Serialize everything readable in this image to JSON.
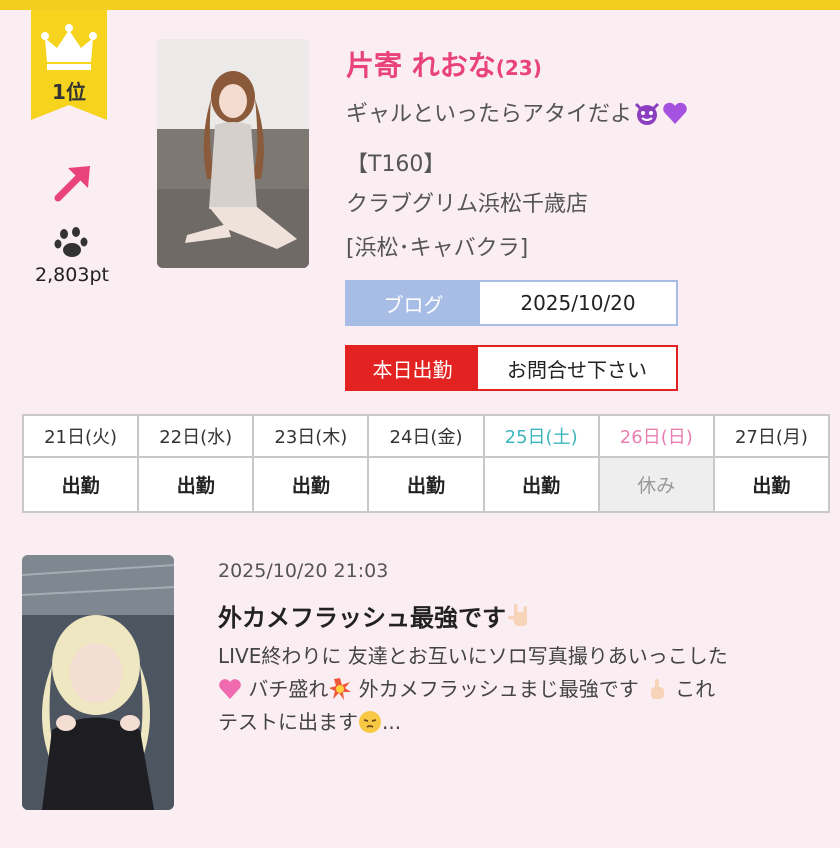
{
  "rank": {
    "label": "1位",
    "trend": "up-right-arrow-icon",
    "points": "2,803pt"
  },
  "cast": {
    "name": "片寄 れおな",
    "age": "(23)",
    "catch": "ギャルといったらアタイだよ",
    "height": "【T160】",
    "shop": "クラブグリム浜松千歳店",
    "area": "[浜松･キャバクラ]"
  },
  "blog_info": {
    "label": "ブログ",
    "date": "2025/10/20"
  },
  "work_info": {
    "label": "本日出勤",
    "value": "お問合せ下さい"
  },
  "schedule": [
    {
      "day": "21日(火)",
      "status": "出勤"
    },
    {
      "day": "22日(水)",
      "status": "出勤"
    },
    {
      "day": "23日(木)",
      "status": "出勤"
    },
    {
      "day": "24日(金)",
      "status": "出勤"
    },
    {
      "day": "25日(土)",
      "status": "出勤"
    },
    {
      "day": "26日(日)",
      "status": "休み"
    },
    {
      "day": "27日(月)",
      "status": "出勤"
    }
  ],
  "blog_post": {
    "datetime": "2025/10/20 21:03",
    "title": "外カメフラッシュ最強です",
    "line1": "LIVE終わりに 友達とお互いにソロ写真撮りあいっこした",
    "line2a": " バチ盛れ",
    "line2b": " 外カメフラッシュまじ最強です",
    "line2c": "  これ",
    "line3": "テストに出ます",
    "line3b": "..."
  },
  "colors": {
    "accent_pink": "#e8437b",
    "work_red": "#e32322",
    "blog_blue": "#a7bde6",
    "sat": "#3db6bd",
    "sun": "#e87fb0",
    "gold": "#f2cf1f"
  }
}
